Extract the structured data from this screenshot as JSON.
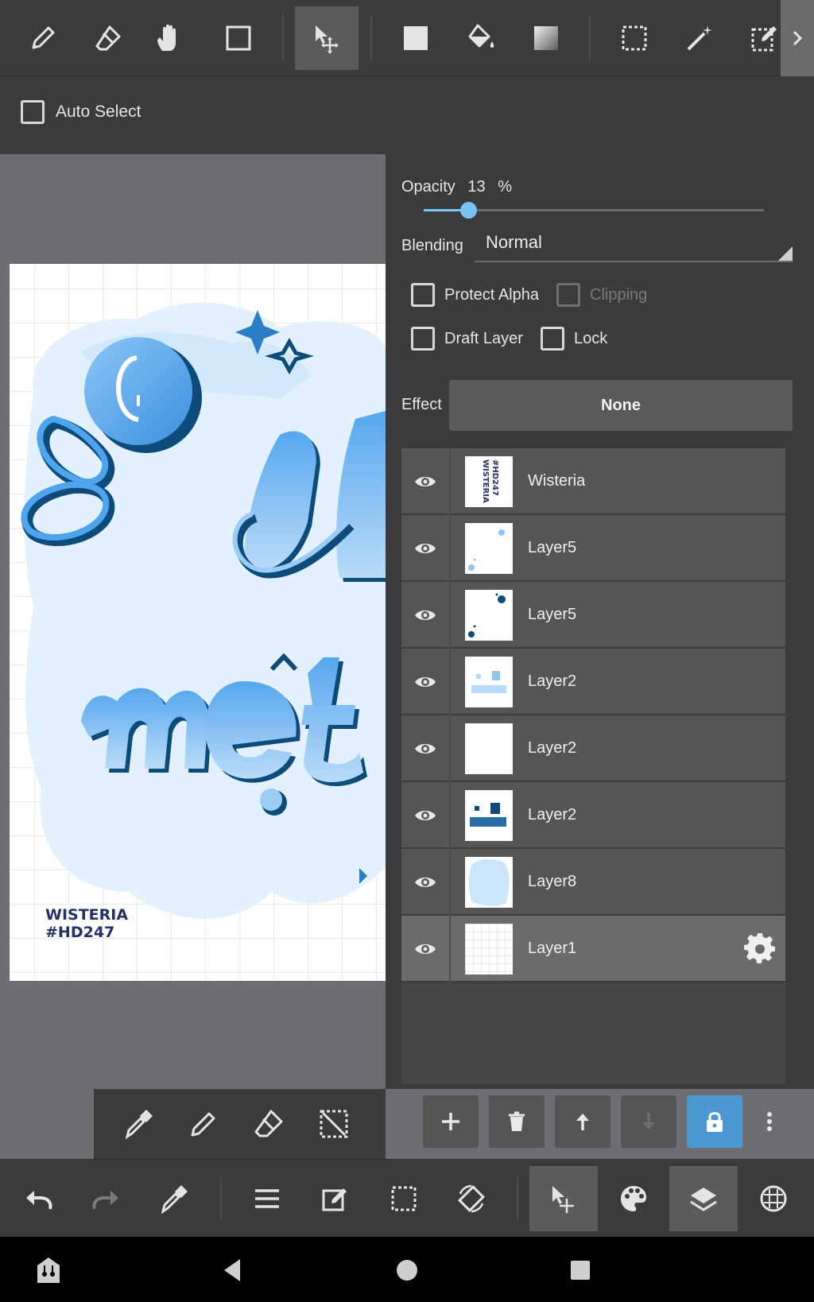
{
  "toolbar": {
    "tools": [
      "pen-icon",
      "eraser-icon",
      "hand-icon",
      "rectangle-icon",
      "move-icon",
      "fill-rect-icon",
      "bucket-icon",
      "gradient-icon",
      "select-rect-icon",
      "magic-wand-icon",
      "select-pen-icon"
    ],
    "active_tool": "move-icon"
  },
  "sub_toolbar": {
    "auto_select_label": "Auto Select"
  },
  "layer_panel": {
    "opacity_label": "Opacity",
    "opacity_value": "13",
    "opacity_unit": "%",
    "opacity_fraction": 0.13,
    "blending_label": "Blending",
    "blending_value": "Normal",
    "protect_alpha_label": "Protect Alpha",
    "clipping_label": "Clipping",
    "draft_layer_label": "Draft Layer",
    "lock_label": "Lock",
    "effect_label": "Effect",
    "effect_value": "None",
    "layers": [
      {
        "name": "Wisteria",
        "thumb": "text"
      },
      {
        "name": "Layer5",
        "thumb": "sparkle-light"
      },
      {
        "name": "Layer5",
        "thumb": "sparkle-dark"
      },
      {
        "name": "Layer2",
        "thumb": "text-light"
      },
      {
        "name": "Layer2",
        "thumb": "blank"
      },
      {
        "name": "Layer2",
        "thumb": "text-dark"
      },
      {
        "name": "Layer8",
        "thumb": "blob"
      },
      {
        "name": "Layer1",
        "thumb": "grid",
        "selected": true
      }
    ]
  },
  "canvas": {
    "watermark_line1": "WISTERIA",
    "watermark_line2": "#HD247"
  },
  "colors": {
    "accent": "#4c98d3",
    "slider": "#79c2f1",
    "panel_bg": "#3b3b3d",
    "canvas_bg": "#6d6e72"
  }
}
